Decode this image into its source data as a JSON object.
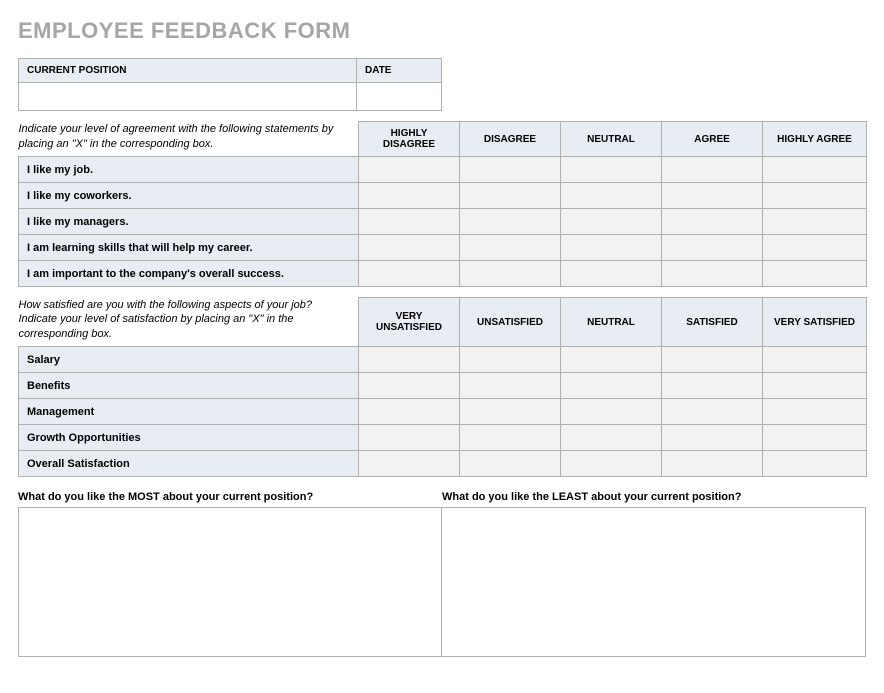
{
  "title": "EMPLOYEE FEEDBACK FORM",
  "info_table": {
    "position_label": "CURRENT POSITION",
    "date_label": "DATE",
    "position_value": "",
    "date_value": ""
  },
  "agreement": {
    "instructions": "Indicate your level of agreement with the following statements by placing an \"X\" in the corresponding box.",
    "columns": [
      "HIGHLY DISAGREE",
      "DISAGREE",
      "NEUTRAL",
      "AGREE",
      "HIGHLY AGREE"
    ],
    "rows": [
      "I like my job.",
      "I like my coworkers.",
      "I like my managers.",
      "I am learning skills that will help my career.",
      "I am important to the company's overall success."
    ]
  },
  "satisfaction": {
    "instructions": "How satisfied are you with the following aspects of your job? Indicate your level of satisfaction by placing an \"X\" in the corresponding box.",
    "columns": [
      "VERY UNSATISFIED",
      "UNSATISFIED",
      "NEUTRAL",
      "SATISFIED",
      "VERY SATISFIED"
    ],
    "rows": [
      "Salary",
      "Benefits",
      "Management",
      "Growth Opportunities",
      "Overall Satisfaction"
    ]
  },
  "open_questions": {
    "most_label": "What do you like the MOST about your current position?",
    "least_label": "What do you like the LEAST about your current position?",
    "most_value": "",
    "least_value": ""
  }
}
